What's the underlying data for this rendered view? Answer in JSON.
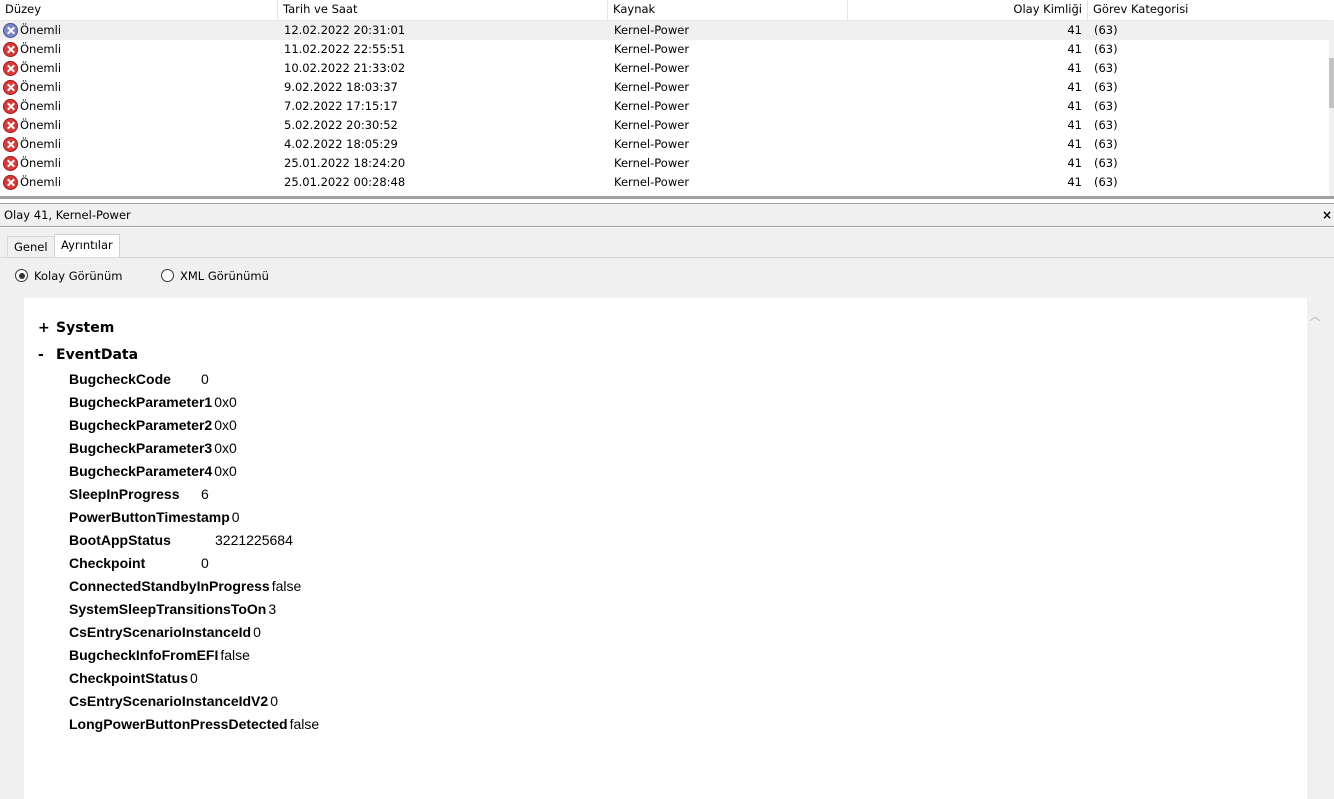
{
  "list": {
    "columns": {
      "level": "Düzey",
      "datetime": "Tarih ve Saat",
      "source": "Kaynak",
      "event_id": "Olay Kimliği",
      "task_category": "Görev Kategorisi"
    },
    "rows": [
      {
        "level": "Önemli",
        "datetime": "12.02.2022 20:31:01",
        "source": "Kernel-Power",
        "event_id": "41",
        "task_category": "(63)"
      },
      {
        "level": "Önemli",
        "datetime": "11.02.2022 22:55:51",
        "source": "Kernel-Power",
        "event_id": "41",
        "task_category": "(63)"
      },
      {
        "level": "Önemli",
        "datetime": "10.02.2022 21:33:02",
        "source": "Kernel-Power",
        "event_id": "41",
        "task_category": "(63)"
      },
      {
        "level": "Önemli",
        "datetime": "9.02.2022 18:03:37",
        "source": "Kernel-Power",
        "event_id": "41",
        "task_category": "(63)"
      },
      {
        "level": "Önemli",
        "datetime": "7.02.2022 17:15:17",
        "source": "Kernel-Power",
        "event_id": "41",
        "task_category": "(63)"
      },
      {
        "level": "Önemli",
        "datetime": "5.02.2022 20:30:52",
        "source": "Kernel-Power",
        "event_id": "41",
        "task_category": "(63)"
      },
      {
        "level": "Önemli",
        "datetime": "4.02.2022 18:05:29",
        "source": "Kernel-Power",
        "event_id": "41",
        "task_category": "(63)"
      },
      {
        "level": "Önemli",
        "datetime": "25.01.2022 18:24:20",
        "source": "Kernel-Power",
        "event_id": "41",
        "task_category": "(63)"
      },
      {
        "level": "Önemli",
        "datetime": "25.01.2022 00:28:48",
        "source": "Kernel-Power",
        "event_id": "41",
        "task_category": "(63)"
      }
    ]
  },
  "detail": {
    "title": "Olay 41, Kernel-Power",
    "close_glyph": "×",
    "tabs": {
      "general": "Genel",
      "details": "Ayrıntılar"
    },
    "view_options": {
      "friendly": "Kolay Görünüm",
      "xml": "XML Görünümü",
      "selected": "friendly"
    },
    "sections": {
      "system": {
        "sign": "+",
        "label": "System"
      },
      "eventdata": {
        "sign": "-",
        "label": "EventData"
      }
    },
    "eventdata": [
      {
        "key": "BugcheckCode",
        "value": "0"
      },
      {
        "key": "BugcheckParameter1",
        "value": "0x0"
      },
      {
        "key": "BugcheckParameter2",
        "value": "0x0"
      },
      {
        "key": "BugcheckParameter3",
        "value": "0x0"
      },
      {
        "key": "BugcheckParameter4",
        "value": "0x0"
      },
      {
        "key": "SleepInProgress",
        "value": "6"
      },
      {
        "key": "PowerButtonTimestamp",
        "value": "0"
      },
      {
        "key": "BootAppStatus",
        "value": "3221225684"
      },
      {
        "key": "Checkpoint",
        "value": "0"
      },
      {
        "key": "ConnectedStandbyInProgress",
        "value": "false"
      },
      {
        "key": "SystemSleepTransitionsToOn",
        "value": "3"
      },
      {
        "key": "CsEntryScenarioInstanceId",
        "value": "0"
      },
      {
        "key": "BugcheckInfoFromEFI",
        "value": "false"
      },
      {
        "key": "CheckpointStatus",
        "value": "0"
      },
      {
        "key": "CsEntryScenarioInstanceIdV2",
        "value": "0"
      },
      {
        "key": "LongPowerButtonPressDetected",
        "value": "false"
      }
    ]
  }
}
